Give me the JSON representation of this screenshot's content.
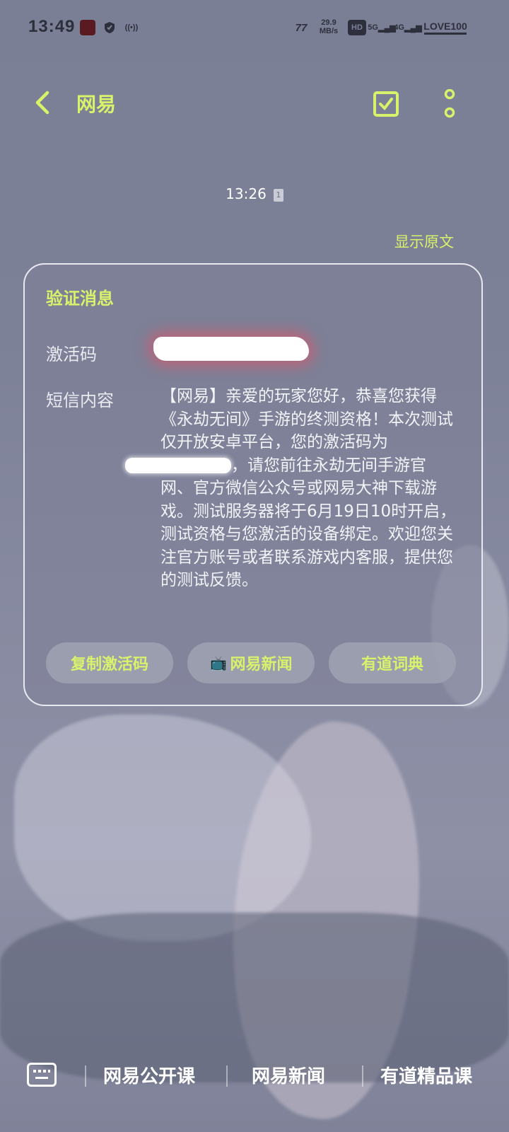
{
  "status_bar": {
    "time": "13:49",
    "speed_value": "29.9",
    "speed_unit": "MB/s",
    "hd": "HD",
    "net5g": "5G",
    "net4g": "4G",
    "battery": "LOVE100"
  },
  "header": {
    "title": "网易"
  },
  "message": {
    "time": "13:26",
    "sim": "1",
    "show_original": "显示原文",
    "card_title": "验证消息",
    "code_label": "激活码",
    "content_label": "短信内容",
    "body_part1": "【网易】亲爱的玩家您好，恭喜您获得《永劫无间》手游的终测资格！本次测试仅开放安卓平台，您的激活码为",
    "body_part2": "，请您前往永劫无间手游官网、官方微信公众号或网易大神下载游戏。测试服务器将于6月19日10时开启，测试资格与您激活的设备绑定。欢迎您关注官方账号或者联系游戏内客服，提供您的测试反馈。",
    "actions": [
      {
        "label": "复制激活码"
      },
      {
        "label": "网易新闻",
        "icon": "tv-icon"
      },
      {
        "label": "有道词典"
      }
    ]
  },
  "bottom_menu": {
    "items": [
      "网易公开课",
      "网易新闻",
      "有道精品课"
    ]
  },
  "colors": {
    "accent": "#d9f26b",
    "background": "#7d8197"
  }
}
